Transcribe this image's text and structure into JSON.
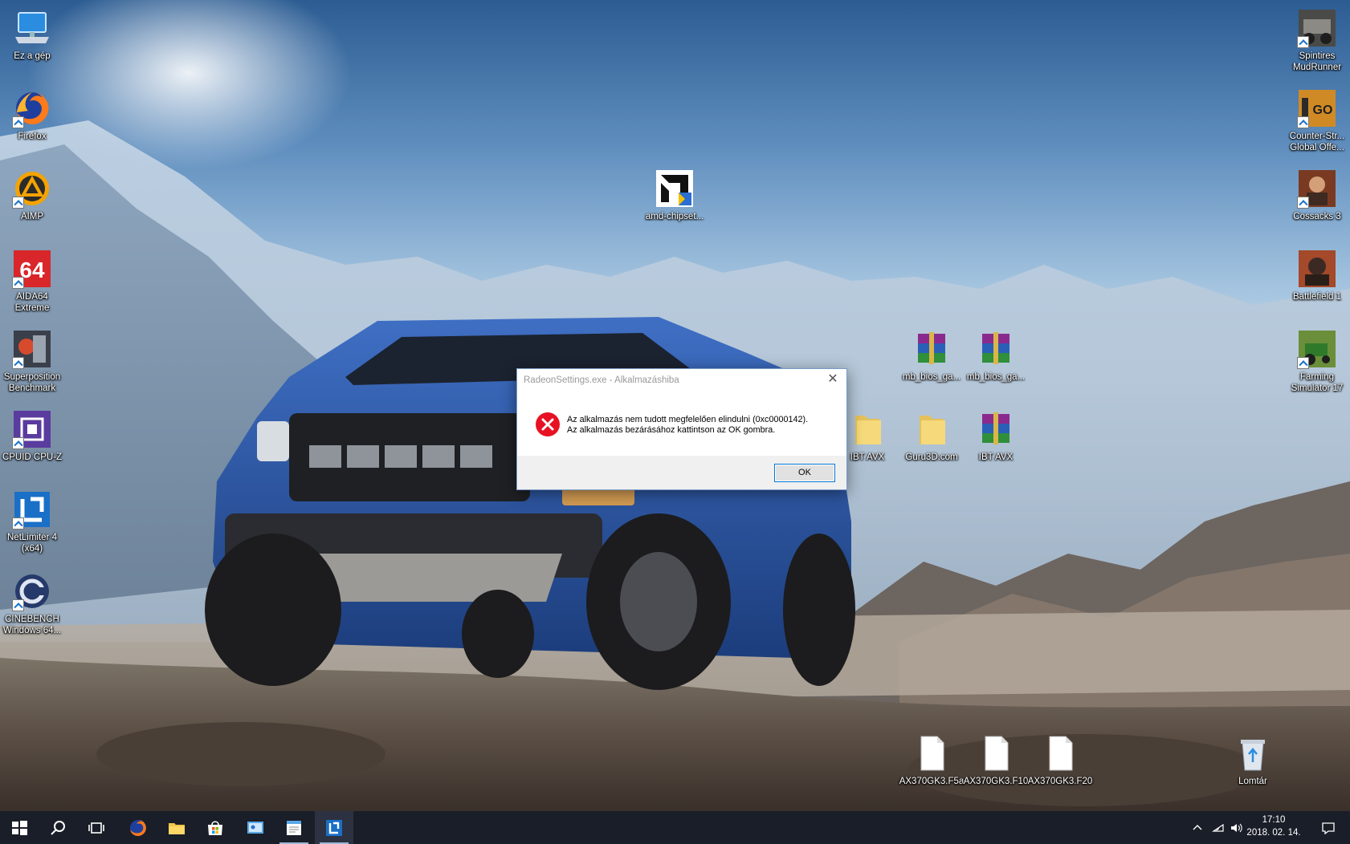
{
  "desktop": {
    "left_icons": [
      {
        "name": "this-pc",
        "label": "Ez a gép"
      },
      {
        "name": "firefox",
        "label": "Firefox"
      },
      {
        "name": "aimp",
        "label": "AIMP"
      },
      {
        "name": "aida64",
        "label": "AIDA64 Extreme"
      },
      {
        "name": "superposition",
        "label": "Superposition Benchmark"
      },
      {
        "name": "cpuz",
        "label": "CPUID CPU-Z"
      },
      {
        "name": "netlimiter",
        "label": "NetLimiter 4 (x64)"
      },
      {
        "name": "cinebench",
        "label": "CINEBENCH Windows 64..."
      }
    ],
    "right_icons": [
      {
        "name": "spintires",
        "label": "Spintires MudRunner"
      },
      {
        "name": "csgo",
        "label": "Counter-Str... Global Offe..."
      },
      {
        "name": "cossacks",
        "label": "Cossacks 3"
      },
      {
        "name": "battlefield",
        "label": "Battlefield 1"
      },
      {
        "name": "farming",
        "label": "Farming Simulator 17"
      }
    ],
    "amd_icon": {
      "label": "amd-chipset..."
    },
    "files": {
      "mb_bios_1": "mb_bios_ga...",
      "mb_bios_2": "mb_bios_ga...",
      "ibt_folder": "IBT AVX",
      "guru3d_folder": "Guru3D.com",
      "ibt_archive": "IBT AVX",
      "ax_f5a": "AX370GK3.F5a",
      "ax_f10": "AX370GK3.F10",
      "ax_f20": "AX370GK3.F20",
      "recycle_bin": "Lomtár"
    }
  },
  "dialog": {
    "title": "RadeonSettings.exe - Alkalmazáshiba",
    "message_line1": "Az alkalmazás nem tudott megfelelően elindulni (0xc0000142).",
    "message_line2": "Az alkalmazás bezárásához kattintson az OK gombra.",
    "ok_label": "OK",
    "close_glyph": "✕",
    "icon": "error-icon"
  },
  "taskbar": {
    "clock_time": "17:10",
    "clock_date": "2018. 02. 14.",
    "pinned": [
      "start-icon",
      "search-icon",
      "task-view-icon",
      "firefox-icon",
      "file-explorer-icon",
      "store-icon",
      "control-panel-icon",
      "notepad-icon",
      "netlimiter-icon"
    ]
  },
  "colors": {
    "taskbar": "#1a1e28",
    "dialog_border": "#7a9cc8",
    "ok_focus": "#0078d7",
    "error_red": "#e81123"
  }
}
